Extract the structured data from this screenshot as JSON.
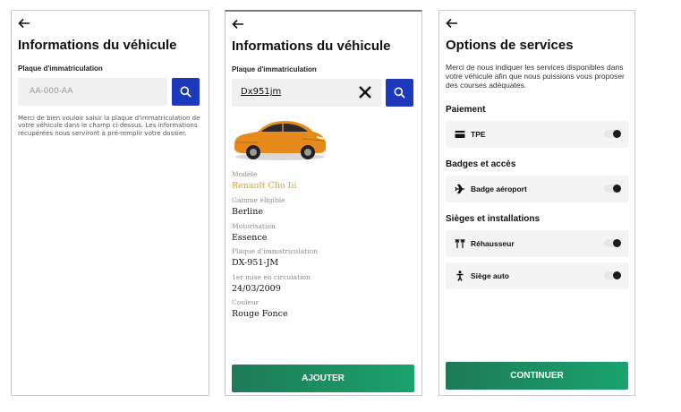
{
  "screen1": {
    "back_icon": "arrow-left-icon",
    "title": "Informations du véhicule",
    "plate_label": "Plaque d'immatriculation",
    "plate_placeholder": "AA-000-AA",
    "search_icon": "search-icon",
    "help_text": "Merci de bien vouloir saisir la plaque d'immatriculation de votre véhicule dans le champ ci-dessus. Les informations récupérées nous serviront à pré-remplir votre dossier."
  },
  "screen2": {
    "back_icon": "arrow-left-icon",
    "title": "Informations du véhicule",
    "plate_label": "Plaque d'immatriculation",
    "plate_value": "Dx951jm",
    "clear_icon": "close-icon",
    "search_icon": "search-icon",
    "car_image": "orange-car-image",
    "fields": [
      {
        "label": "Modèle",
        "value": "Renault Clio Iii"
      },
      {
        "label": "Gamme éligible",
        "value": "Berline"
      },
      {
        "label": "Motorisation",
        "value": "Essence"
      },
      {
        "label": "Plaque d'immatriculation",
        "value": "DX-951-JM"
      },
      {
        "label": "1er mise en circulation",
        "value": "24/03/2009"
      },
      {
        "label": "Couleur",
        "value": "Rouge Fonce"
      }
    ],
    "add_button": "AJOUTER",
    "accent_color": "#e59c1e"
  },
  "screen3": {
    "back_icon": "arrow-left-icon",
    "title": "Options de services",
    "intro": "Merci de nous indiquer les services disponibles dans votre véhicule afin que nous puissions vous proposer des courses adéquates.",
    "sections": [
      {
        "title": "Paiement",
        "options": [
          {
            "label": "TPE",
            "icon": "credit-card-icon"
          }
        ]
      },
      {
        "title": "Badges et accès",
        "options": [
          {
            "label": "Badge aéroport",
            "icon": "airplane-icon"
          }
        ]
      },
      {
        "title": "Sièges et installations",
        "options": [
          {
            "label": "Réhausseur",
            "icon": "booster-seat-icon"
          },
          {
            "label": "Siège auto",
            "icon": "child-seat-icon"
          }
        ]
      }
    ],
    "continue_button": "CONTINUER"
  },
  "colors": {
    "primary_blue": "#1c39bb",
    "green_start": "#1e7a57",
    "green_end": "#1aa36e"
  }
}
